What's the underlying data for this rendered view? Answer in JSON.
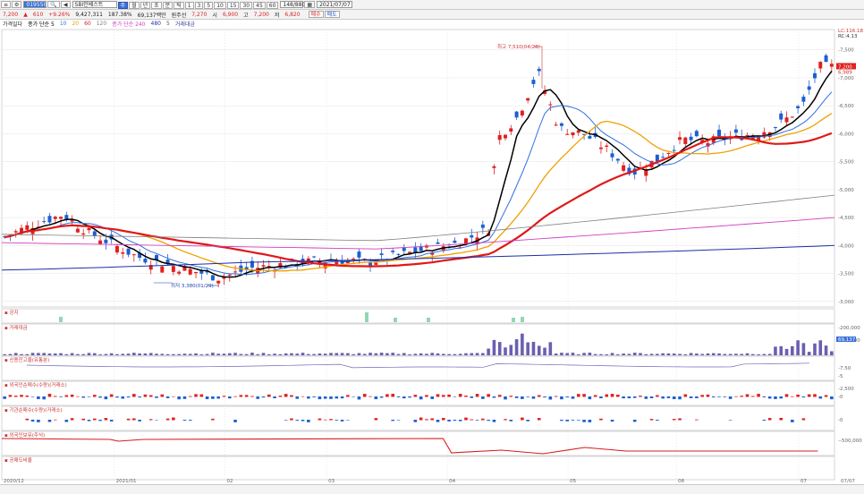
{
  "toolbar": {
    "code": "019550",
    "name": "SBI인베스트",
    "chart_types": [
      "주",
      "월",
      "년",
      "초",
      "분",
      "틱"
    ],
    "periods": [
      "1",
      "3",
      "5",
      "10",
      "15",
      "30",
      "45",
      "60"
    ],
    "count": "148/880",
    "date": "2021/07/07"
  },
  "quote": {
    "price": "7,200",
    "change_arrow": "▲",
    "change": "610",
    "change_pct": "+9.26%",
    "volume": "9,427,311",
    "volume_pct": "187.38%",
    "amount": "69,137백만",
    "prev_label": "원주선",
    "ref_price": "7,270",
    "open_label": "시",
    "open": "6,900",
    "high_label": "고",
    "high": "7,200",
    "low_label": "저",
    "low": "6,820",
    "buy_button": "매수",
    "sell_button": "매도"
  },
  "legend": {
    "price_title": "가격일다",
    "ma_label": "종가 단순 5",
    "ma_periods": [
      "10",
      "20",
      "60",
      "120"
    ],
    "ma2_label": "종가 단순 240",
    "ma2_periods": [
      "480",
      "5"
    ],
    "value_label": "거래대금",
    "right_top": "LC:116.18",
    "right_bottom": "RC:4.13"
  },
  "annotations": {
    "high": "최고 7,510(04/28)",
    "low": "최저 3,380(01/29)"
  },
  "panels": {
    "p1": "공지",
    "p2": "거래대금",
    "p3": "신용잔고율(유통분)",
    "p4": "외국인순매수(수량)(거래소)",
    "p5": "기관순매수(수량)(거래소)",
    "p6": "외국인보유(주식)",
    "p7": "공매도비율"
  },
  "xaxis": [
    "2020/12",
    "2021/01",
    "02",
    "03",
    "04",
    "05",
    "06",
    "07",
    "07/07"
  ],
  "chart_data": [
    {
      "type": "candlestick",
      "ylim": [
        2900,
        7800
      ],
      "yticks": [
        "7,500",
        "7,000",
        "6,500",
        "6,000",
        "5,500",
        "5,000",
        "4,500",
        "4,000",
        "3,500",
        "3,000"
      ],
      "last_label": "7,200",
      "last_label2": "6,989",
      "ma_colors": {
        "ma5": "#000000",
        "ma10": "#2f6fe0",
        "ma20": "#f0a000",
        "ma60": "#e01818",
        "ma120": "#7f7f7f",
        "ma240": "#d03fc0",
        "ma480": "#1d2fa5"
      },
      "ma_end_values": {
        "ma120": 4900,
        "ma240": 4500,
        "ma480": 4000,
        "ma60": 5950
      }
    },
    {
      "type": "bar",
      "name": "거래대금",
      "yticks": [
        "200,000",
        "100,000"
      ],
      "last_label": "69,137",
      "last_label2": "49,000"
    },
    {
      "type": "line",
      "name": "신용잔고율(유통분)",
      "yticks": [
        "7.50",
        "5"
      ]
    },
    {
      "type": "bar",
      "name": "외국인순매수(수량)(거래소)",
      "yticks": [
        "2,500",
        "0"
      ]
    },
    {
      "type": "bar",
      "name": "기관순매수(수량)(거래소)",
      "yticks": [
        "0"
      ]
    },
    {
      "type": "line",
      "name": "외국인보유(주식)",
      "yticks": [
        "-500,000"
      ]
    }
  ]
}
